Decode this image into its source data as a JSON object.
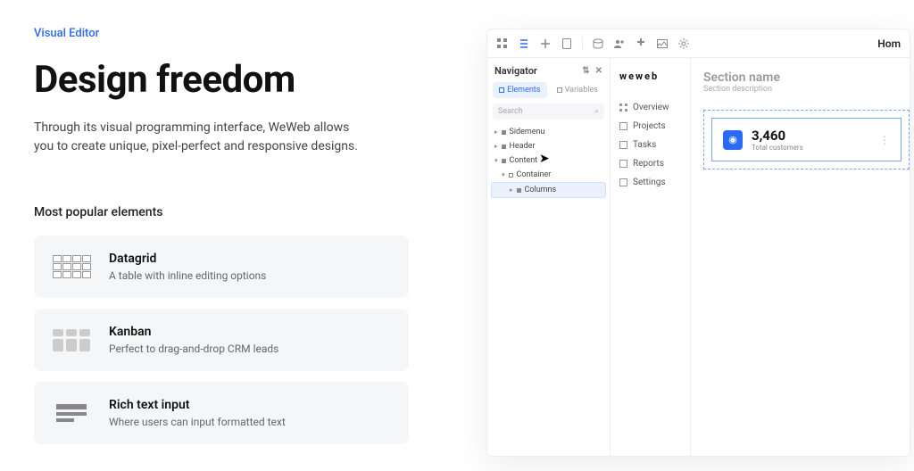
{
  "left": {
    "eyebrow": "Visual Editor",
    "title": "Design freedom",
    "description": "Through its visual programming interface, WeWeb allows you to create unique, pixel-perfect and responsive designs.",
    "subhead": "Most popular elements",
    "cards": [
      {
        "title": "Datagrid",
        "desc": "A table with inline editing options"
      },
      {
        "title": "Kanban",
        "desc": "Perfect to drag-and-drop CRM leads"
      },
      {
        "title": "Rich text input",
        "desc": "Where users can input formatted text"
      }
    ]
  },
  "editor": {
    "home_label": "Hom",
    "navigator_title": "Navigator",
    "tabs": {
      "elements": "Elements",
      "variables": "Variables"
    },
    "search_placeholder": "Search",
    "tree": {
      "sidemenu": "Sidemenu",
      "header": "Header",
      "content": "Content",
      "container": "Container",
      "columns": "Columns"
    },
    "brand": "weweb",
    "menu": {
      "overview": "Overview",
      "projects": "Projects",
      "tasks": "Tasks",
      "reports": "Reports",
      "settings": "Settings"
    },
    "section": {
      "title": "Section name",
      "desc": "Section description"
    },
    "stat": {
      "value": "3,460",
      "label": "Total customers"
    }
  }
}
